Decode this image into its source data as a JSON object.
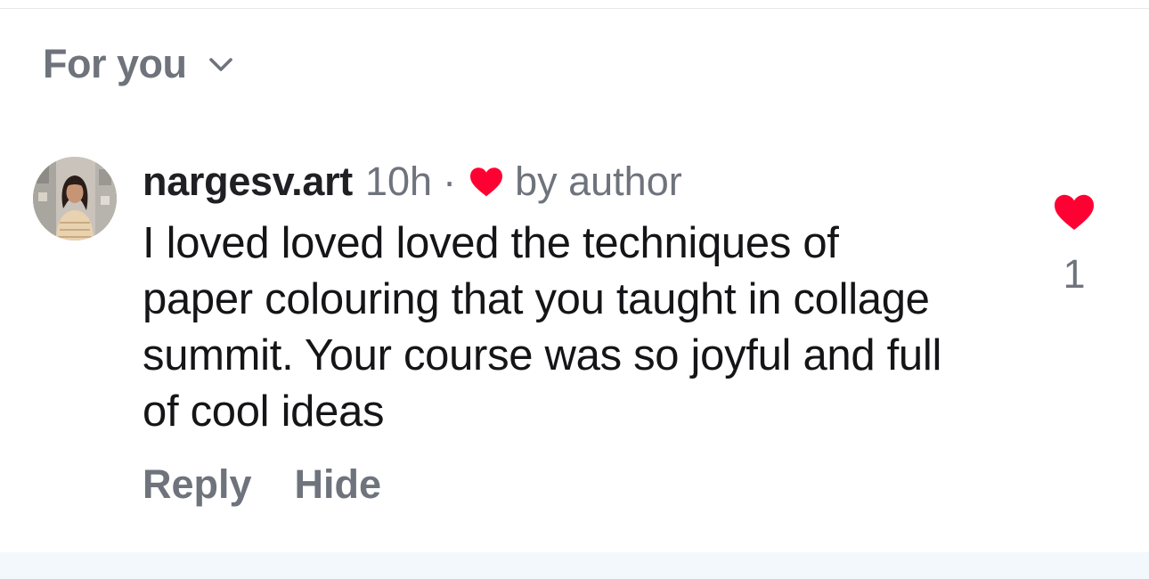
{
  "sort": {
    "label": "For you",
    "icon": "chevron-down-icon"
  },
  "comment": {
    "username": "nargesv.art",
    "timestamp": "10h",
    "separator": "·",
    "author_like_label": "by author",
    "text": "I loved loved loved the techniques of paper colouring that you taught in collage summit. Your course was so joyful and full of cool ideas",
    "actions": {
      "reply": "Reply",
      "hide": "Hide"
    },
    "like_count": "1"
  },
  "colors": {
    "heart": "#ff0033",
    "secondary_text": "#6e737c",
    "primary_text": "#151518",
    "bottom_band": "#f3f8fd"
  }
}
